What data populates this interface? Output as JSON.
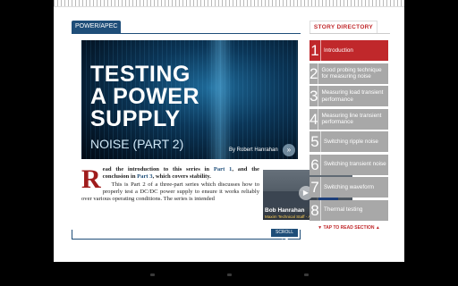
{
  "section_tab": "POWER/APEC",
  "hero": {
    "title": "TESTING\nA POWER\nSUPPLY",
    "subtitle": "NOISE (PART 2)",
    "byline": "By Robert Hanrahan",
    "go_icon": "»"
  },
  "article": {
    "dropcap": "R",
    "intro_1": "ead the introduction to this series in ",
    "link_1": "Part 1",
    "intro_2": ", and the conclusion in ",
    "link_2": "Part 3",
    "intro_3": ", which covers stability.",
    "body": "This is Part 2 of a three-part series which discusses how to properly test a DC/DC power supply to ensure it works reliably over various operating conditions. The series is intended"
  },
  "video": {
    "name": "Bob Hanrahan",
    "role": "Maxim Technical Staff - Analog Field Applications",
    "play_icon": "▶"
  },
  "scroll_button": "SCROLL ▲▼",
  "directory": {
    "header": "STORY DIRECTORY",
    "items": [
      {
        "num": "1",
        "label": "Introduction",
        "active": true
      },
      {
        "num": "2",
        "label": "Good probing technique for measuring noise",
        "active": false
      },
      {
        "num": "3",
        "label": "Measuring load transient performance",
        "active": false
      },
      {
        "num": "4",
        "label": "Measuring line transient performance",
        "active": false
      },
      {
        "num": "5",
        "label": "Switching ripple noise",
        "active": false
      },
      {
        "num": "6",
        "label": "Switching transient noise",
        "active": false
      },
      {
        "num": "7",
        "label": "Switching waveform",
        "active": false
      },
      {
        "num": "8",
        "label": "Thermal testing",
        "active": false
      }
    ],
    "tap_to_read": "▼ TAP TO READ SECTION ▲"
  },
  "colors": {
    "accent": "#c0282b",
    "brand": "#1f4e79",
    "inactive": "#a8a8a8"
  },
  "android_nav": [
    "back-icon",
    "home-icon",
    "recents-icon"
  ]
}
